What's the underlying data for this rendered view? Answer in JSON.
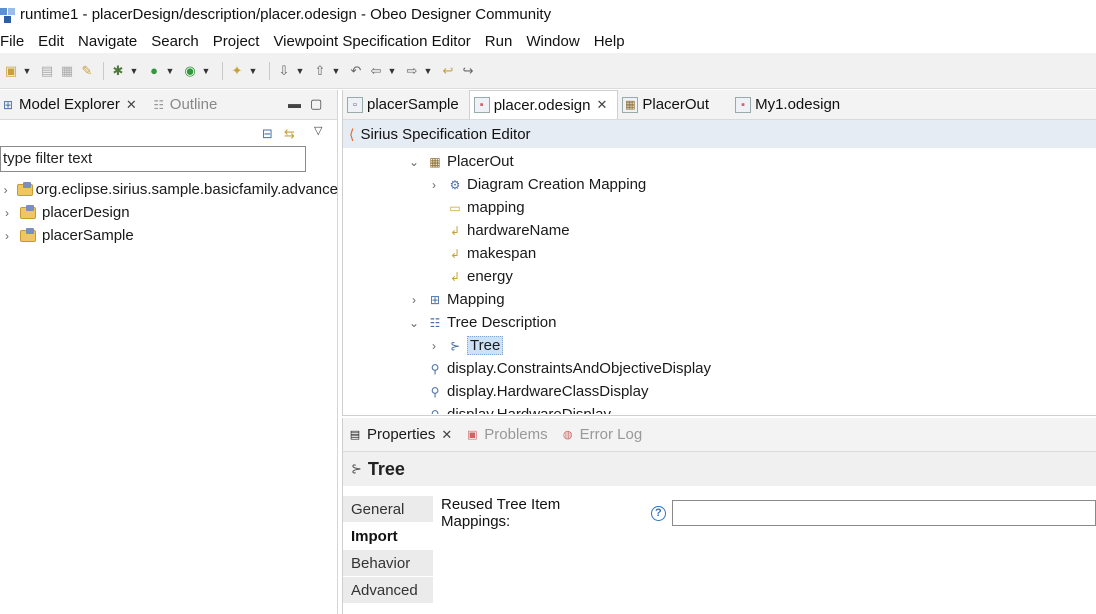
{
  "window": {
    "title": "runtime1 - placerDesign/description/placer.odesign - Obeo Designer Community"
  },
  "menu": [
    "File",
    "Edit",
    "Navigate",
    "Search",
    "Project",
    "Viewpoint Specification Editor",
    "Run",
    "Window",
    "Help"
  ],
  "left_panel": {
    "tabs": [
      {
        "label": "Model Explorer",
        "active": true
      },
      {
        "label": "Outline",
        "active": false
      }
    ],
    "filter_placeholder": "type filter text",
    "items": [
      {
        "label": "org.eclipse.sirius.sample.basicfamily.advance"
      },
      {
        "label": "placerDesign"
      },
      {
        "label": "placerSample"
      }
    ]
  },
  "editor": {
    "tabs": [
      {
        "label": "placerSample",
        "active": false
      },
      {
        "label": "placer.odesign",
        "active": true
      },
      {
        "label": "PlacerOut",
        "active": false
      },
      {
        "label": "My1.odesign",
        "active": false
      }
    ],
    "header": "Sirius Specification Editor",
    "tree": [
      {
        "label": "PlacerOut",
        "chev": "v",
        "icon": "table-icon"
      },
      {
        "label": "Diagram Creation Mapping",
        "chev": ">",
        "icon": "mapping-icon"
      },
      {
        "label": "mapping",
        "chev": "",
        "icon": "column-icon"
      },
      {
        "label": "hardwareName",
        "chev": "",
        "icon": "feature-icon"
      },
      {
        "label": "makespan",
        "chev": "",
        "icon": "feature-icon"
      },
      {
        "label": "energy",
        "chev": "",
        "icon": "feature-icon"
      },
      {
        "label": "Mapping",
        "chev": ">",
        "icon": "diagram-icon"
      },
      {
        "label": "Tree Description",
        "chev": "v",
        "icon": "tree-desc-icon"
      },
      {
        "label": "Tree",
        "chev": ">",
        "icon": "tree-icon",
        "selected": true
      },
      {
        "label": "display.ConstraintsAndObjectiveDisplay",
        "chev": "",
        "icon": "java-icon"
      },
      {
        "label": "display.HardwareClassDisplay",
        "chev": "",
        "icon": "java-icon"
      },
      {
        "label": "display.HardwareDisplay",
        "chev": "",
        "icon": "java-icon"
      }
    ]
  },
  "properties": {
    "tabs": [
      {
        "label": "Properties",
        "active": true
      },
      {
        "label": "Problems",
        "active": false
      },
      {
        "label": "Error Log",
        "active": false
      }
    ],
    "title": "Tree",
    "side_tabs": [
      {
        "label": "General",
        "active": false
      },
      {
        "label": "Import",
        "active": true
      },
      {
        "label": "Behavior",
        "active": false
      },
      {
        "label": "Advanced",
        "active": false
      }
    ],
    "field_label": "Reused Tree Item Mappings:",
    "help_glyph": "?"
  }
}
